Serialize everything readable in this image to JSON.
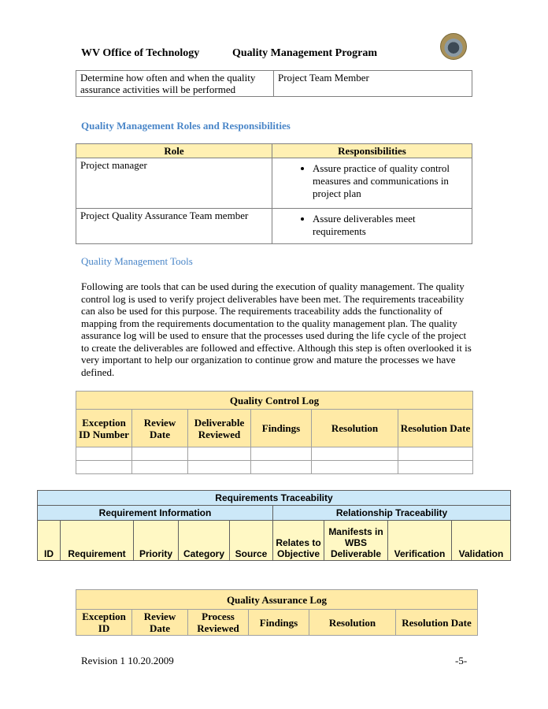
{
  "header": {
    "org": "WV Office of Technology",
    "program": "Quality Management Program",
    "seal_icon": "state-seal-icon"
  },
  "continued_table": {
    "rows": [
      {
        "activity": "Determine how often and when the quality assurance activities will be performed",
        "responsible": "Project Team Member"
      }
    ]
  },
  "roles_section": {
    "title": "Quality Management Roles and Responsibilities",
    "columns": [
      "Role",
      "Responsibilities"
    ],
    "rows": [
      {
        "role": "Project manager",
        "responsibility": "Assure practice of quality control measures and communications in project plan"
      },
      {
        "role": "Project Quality Assurance Team member",
        "responsibility": "Assure deliverables meet requirements"
      }
    ]
  },
  "tools_section": {
    "title": "Quality Management Tools",
    "paragraph": "Following are tools that can be used during the execution of quality management.  The quality control log is used to verify project deliverables have been met.  The requirements traceability can also be used for this purpose.  The requirements traceability adds the functionality of mapping from the requirements documentation to the quality management plan.  The quality assurance log will be used to ensure that the processes used during the life cycle of the project to create the deliverables are followed and effective.  Although this step is often overlooked it is very important to help our organization to continue grow and mature the processes we have defined."
  },
  "quality_control_log": {
    "title": "Quality Control Log",
    "columns": [
      "Exception ID Number",
      "Review Date",
      "Deliverable Reviewed",
      "Findings",
      "Resolution",
      "Resolution Date"
    ]
  },
  "requirements_traceability": {
    "title": "Requirements Traceability",
    "groups": [
      "Requirement Information",
      "Relationship Traceability"
    ],
    "columns": [
      "ID",
      "Requirement",
      "Priority",
      "Category",
      "Source",
      "Relates to Objective",
      "Manifests in WBS Deliverable",
      "Verification",
      "Validation"
    ]
  },
  "quality_assurance_log": {
    "title": "Quality Assurance Log",
    "columns": [
      "Exception ID",
      "Review Date",
      "Process Reviewed",
      "Findings",
      "Resolution",
      "Resolution Date"
    ]
  },
  "footer": {
    "revision": "Revision 1 10.20.2009",
    "page": "-5-"
  }
}
